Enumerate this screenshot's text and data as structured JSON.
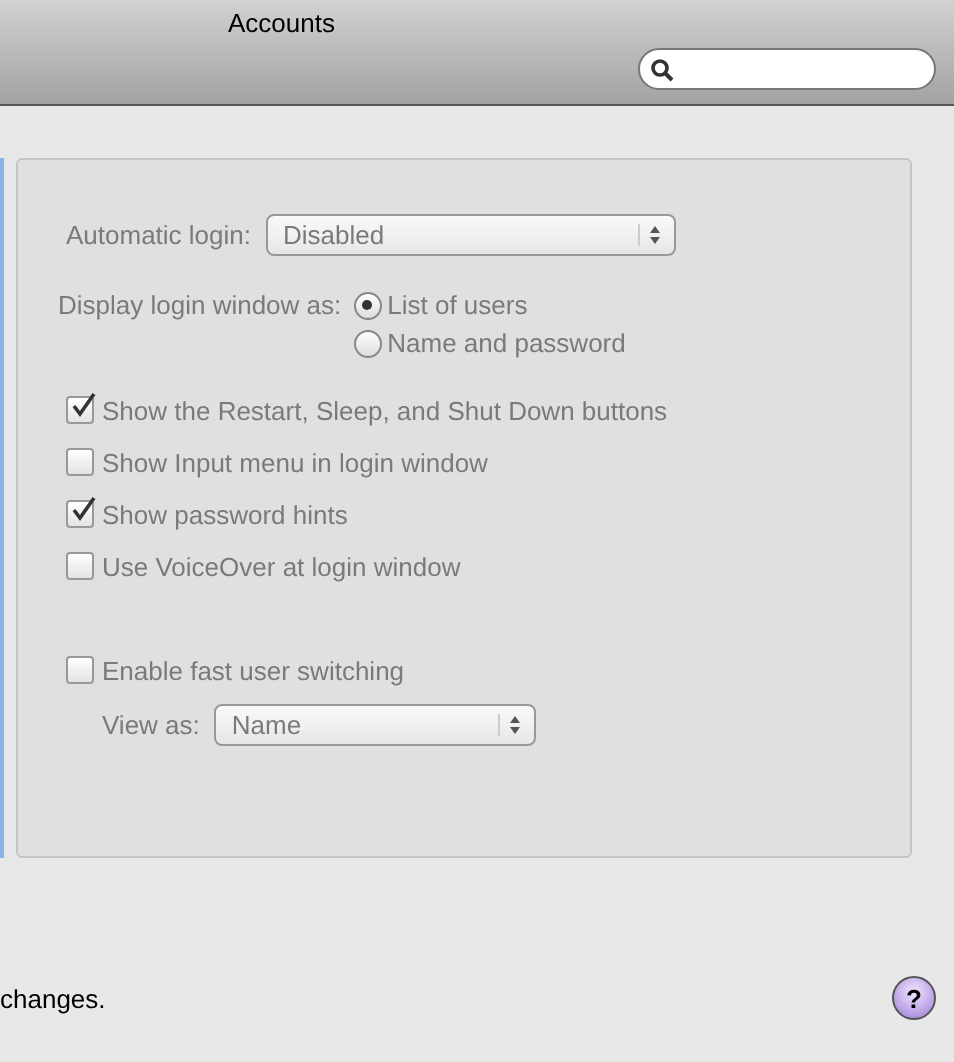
{
  "window": {
    "title": "Accounts"
  },
  "settings": {
    "disabled": true,
    "automatic_login": {
      "label": "Automatic login:",
      "value": "Disabled"
    },
    "display_login": {
      "label": "Display login window as:",
      "options": [
        {
          "label": "List of users",
          "selected": true
        },
        {
          "label": "Name and password",
          "selected": false
        }
      ]
    },
    "checkboxes": [
      {
        "label": "Show the Restart, Sleep, and Shut Down buttons",
        "checked": true
      },
      {
        "label": "Show Input menu in login window",
        "checked": false
      },
      {
        "label": "Show password hints",
        "checked": true
      },
      {
        "label": "Use VoiceOver at login window",
        "checked": false
      }
    ],
    "fast_switching": {
      "label": "Enable fast user switching",
      "checked": false
    },
    "view_as": {
      "label": "View as:",
      "value": "Name"
    }
  },
  "footer": {
    "text": "changes.",
    "help": "?"
  }
}
